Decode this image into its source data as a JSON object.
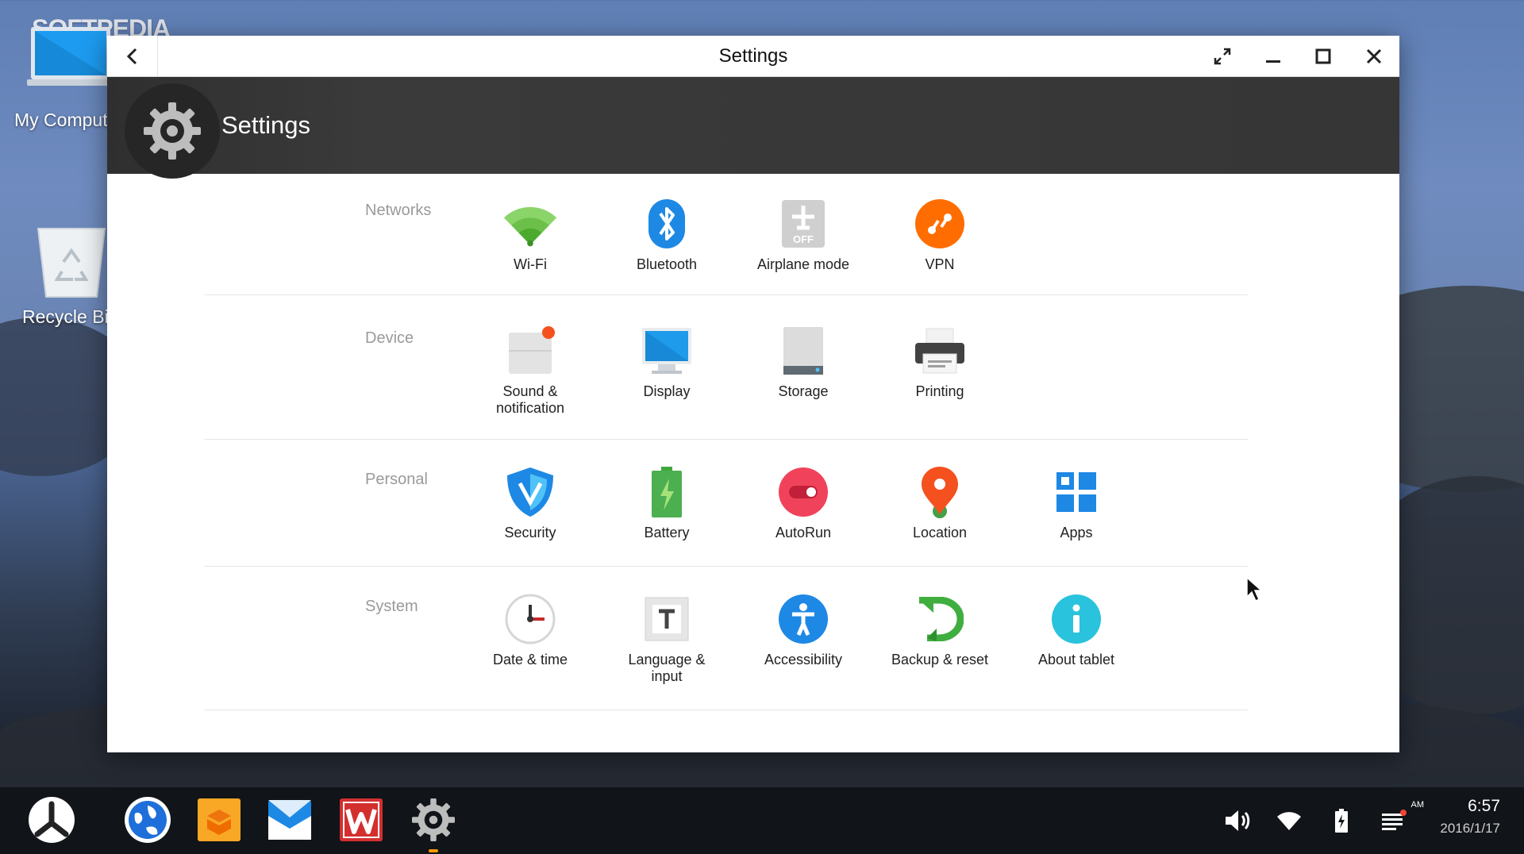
{
  "desktop": {
    "watermark": "SOFTPEDIA",
    "icons": [
      {
        "label": "My Comput"
      },
      {
        "label": "Recycle Bi"
      }
    ]
  },
  "window": {
    "title": "Settings",
    "header_title": "Settings"
  },
  "sections": [
    {
      "category": "Networks",
      "items": [
        {
          "label": "Wi-Fi"
        },
        {
          "label": "Bluetooth"
        },
        {
          "label": "Airplane mode"
        },
        {
          "label": "VPN"
        }
      ]
    },
    {
      "category": "Device",
      "items": [
        {
          "label": "Sound &\nnotification"
        },
        {
          "label": "Display"
        },
        {
          "label": "Storage"
        },
        {
          "label": "Printing"
        }
      ]
    },
    {
      "category": "Personal",
      "items": [
        {
          "label": "Security"
        },
        {
          "label": "Battery"
        },
        {
          "label": "AutoRun"
        },
        {
          "label": "Location"
        },
        {
          "label": "Apps"
        }
      ]
    },
    {
      "category": "System",
      "items": [
        {
          "label": "Date & time"
        },
        {
          "label": "Language &\ninput"
        },
        {
          "label": "Accessibility"
        },
        {
          "label": "Backup & reset"
        },
        {
          "label": "About tablet"
        }
      ]
    }
  ],
  "airplane_badge": "OFF",
  "taskbar": {
    "clock_ampm": "AM",
    "clock_time": "6:57",
    "clock_date": "2016/1/17"
  },
  "colors": {
    "wifi": "#6cc04a",
    "bluetooth": "#1e88e5",
    "vpn": "#ff6d00",
    "autorun": "#f0435b",
    "location": "#f4511e",
    "apps": "#1e88e5",
    "accessibility": "#1e88e5",
    "backup": "#3fae3f",
    "about": "#29c3dd"
  }
}
